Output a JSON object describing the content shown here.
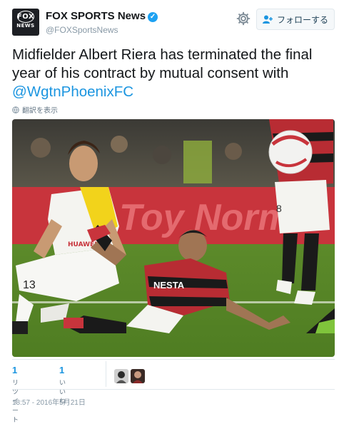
{
  "account": {
    "display_name": "FOX SPORTS News",
    "handle": "@FOXSportsNews",
    "avatar_label_top": "FOX",
    "avatar_label_bottom": "NEWS",
    "verified": true
  },
  "follow_button": {
    "label": "フォローする"
  },
  "tweet": {
    "text": "Midfielder Albert Riera has terminated the final year of his contract by mutual consent with ",
    "mention": "@WgtnPhoenixFC",
    "translate_label": "翻訳を表示"
  },
  "photo": {
    "banner_text": "Toy Norma",
    "player_left_number": "13",
    "player_left_sponsor": "HUAWEI",
    "player_right_sponsor": "NESTA",
    "player_far_number": "8"
  },
  "stats": {
    "retweets": {
      "count": "1",
      "label": "リツイート"
    },
    "likes": {
      "count": "1",
      "label": "いいね"
    }
  },
  "timestamp": "18:57 - 2016年5月21日",
  "colors": {
    "link": "#1b95e0",
    "muted": "#657786",
    "verified": "#1da1f2",
    "border": "#e1e8ed"
  },
  "icons": [
    "gear-icon",
    "follow-person-icon",
    "verified-badge-icon",
    "globe-icon"
  ]
}
